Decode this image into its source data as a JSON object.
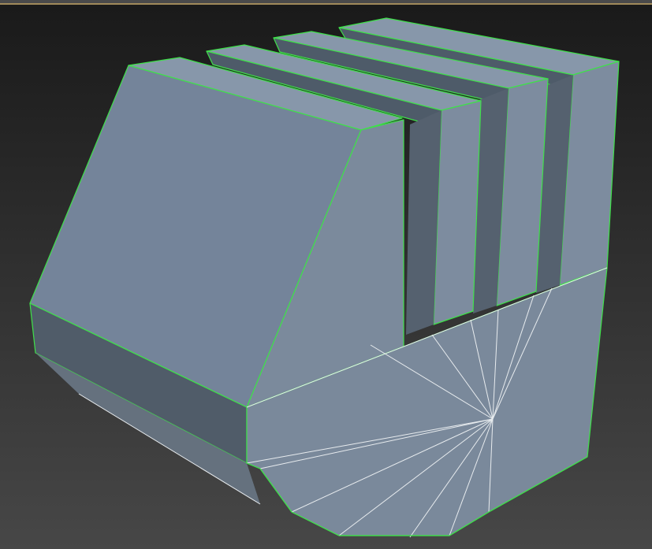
{
  "viewport": {
    "object_type": "editable-poly-mesh",
    "colors": {
      "background_top": "#1a1a1a",
      "background_bottom": "#474747",
      "face_light": "#7b8a9c",
      "face_top": "#8797aa",
      "face_dark": "#4e5b69",
      "selection_edge": "#3fe04a",
      "wire_edge": "#e8ecef",
      "frame_accent": "#a08a5a"
    }
  }
}
